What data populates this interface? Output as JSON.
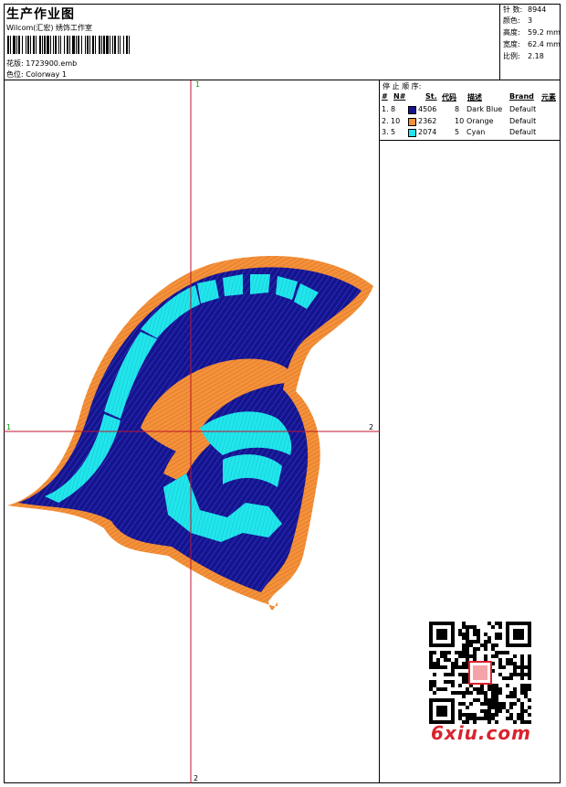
{
  "header": {
    "title": "生产作业图",
    "studio": "Wilcom(汇宏) 绣饰工作室",
    "design_label": "花版:",
    "design_file": "1723900.emb",
    "colorway_label": "色位:",
    "colorway": "Colorway 1"
  },
  "stats": [
    {
      "label": "针 数:",
      "value": "8944"
    },
    {
      "label": "颜色:",
      "value": "3"
    },
    {
      "label": "高度:",
      "value": "59.2 mm"
    },
    {
      "label": "宽度:",
      "value": "62.4 mm"
    },
    {
      "label": "比例:",
      "value": "2.18"
    }
  ],
  "stop_sequence": {
    "title": "停 止 顺 序:",
    "columns": [
      "#",
      "N#",
      "St.",
      "代码",
      "描述",
      "Brand",
      "元素"
    ],
    "rows": [
      {
        "index": "1.",
        "n": "8",
        "color": "#14148c",
        "st": "4506",
        "code": "8",
        "desc": "Dark Blue",
        "brand": "Default"
      },
      {
        "index": "2.",
        "n": "10",
        "color": "#f5913a",
        "st": "2362",
        "code": "10",
        "desc": "Orange",
        "brand": "Default"
      },
      {
        "index": "3.",
        "n": "5",
        "color": "#21e6ec",
        "st": "2074",
        "code": "5",
        "desc": "Cyan",
        "brand": "Default"
      }
    ]
  },
  "crosshair": {
    "top": "1",
    "left": "1",
    "right": "2",
    "bottom": "2"
  },
  "watermark": {
    "logo": "6xiu.com"
  },
  "colors": {
    "dark_blue": "#14148c",
    "orange": "#f5913a",
    "cyan": "#21e6ec",
    "cross": "#c0142c"
  }
}
